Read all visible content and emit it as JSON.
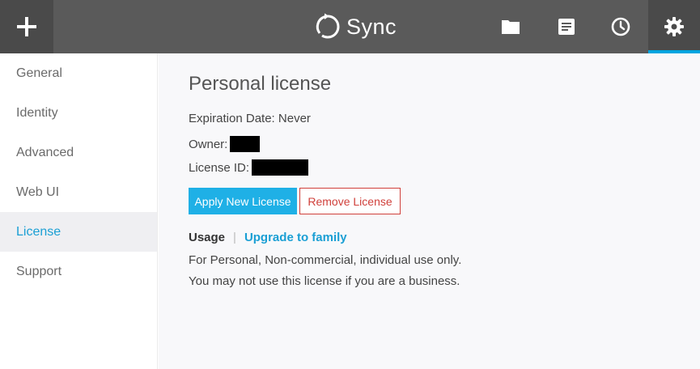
{
  "app": {
    "name": "Sync"
  },
  "header": {
    "add_icon": "plus-icon",
    "nav": [
      {
        "name": "files",
        "icon": "folder-icon"
      },
      {
        "name": "notes",
        "icon": "notes-icon"
      },
      {
        "name": "history",
        "icon": "clock-icon"
      },
      {
        "name": "settings",
        "icon": "gear-icon",
        "active": true
      }
    ],
    "accent_color": "#00a5e0"
  },
  "sidebar": {
    "items": [
      {
        "label": "General"
      },
      {
        "label": "Identity"
      },
      {
        "label": "Advanced"
      },
      {
        "label": "Web UI"
      },
      {
        "label": "License",
        "active": true
      },
      {
        "label": "Support"
      }
    ]
  },
  "license": {
    "title": "Personal license",
    "expiration": "Expiration Date: Never",
    "owner_label": "Owner:",
    "license_id_label": "License ID:",
    "apply_button": "Apply New License",
    "remove_button": "Remove License",
    "usage_label": "Usage",
    "usage_separator": "|",
    "upgrade_link": "Upgrade to family",
    "description_line1": "For Personal, Non-commercial, individual use only.",
    "description_line2": "You may not use this license if you are a business."
  },
  "colors": {
    "primary": "#1fb0e6",
    "danger": "#d0403b",
    "topbar": "#5a5a5a"
  }
}
